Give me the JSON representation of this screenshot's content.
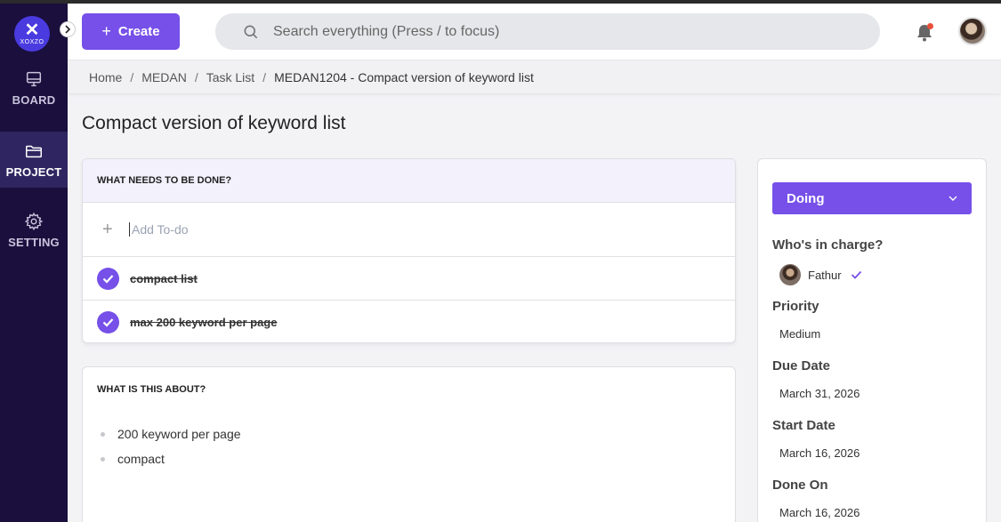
{
  "sidebar": {
    "logo_text": "XOXZO",
    "items": [
      {
        "label": "BOARD",
        "icon": "monitor-icon"
      },
      {
        "label": "PROJECT",
        "icon": "folder-icon"
      },
      {
        "label": "SETTING",
        "icon": "gear-icon"
      }
    ],
    "active": "PROJECT"
  },
  "header": {
    "create_label": "Create",
    "search_placeholder": "Search everything (Press / to focus)"
  },
  "breadcrumb": [
    "Home",
    "MEDAN",
    "Task List",
    "MEDAN1204 - Compact version of keyword list"
  ],
  "task": {
    "title": "Compact version of keyword list",
    "todo_header": "WHAT NEEDS TO BE DONE?",
    "add_todo_placeholder": "Add To-do",
    "todos": [
      {
        "text": "compact list",
        "done": true
      },
      {
        "text": "max 200 keyword per page",
        "done": true
      }
    ],
    "about_header": "WHAT IS THIS ABOUT?",
    "about_items": [
      "200 keyword per page",
      "compact"
    ]
  },
  "details": {
    "status": "Doing",
    "in_charge_label": "Who's in charge?",
    "assignee": "Fathur",
    "priority_label": "Priority",
    "priority": "Medium",
    "due_label": "Due Date",
    "due": "March 31, 2026",
    "start_label": "Start Date",
    "start": "March 16, 2026",
    "done_label": "Done On",
    "done": "March 16, 2026"
  },
  "colors": {
    "accent": "#7650e8",
    "sidebar": "#1a0f3d",
    "notification": "#e8503a"
  }
}
